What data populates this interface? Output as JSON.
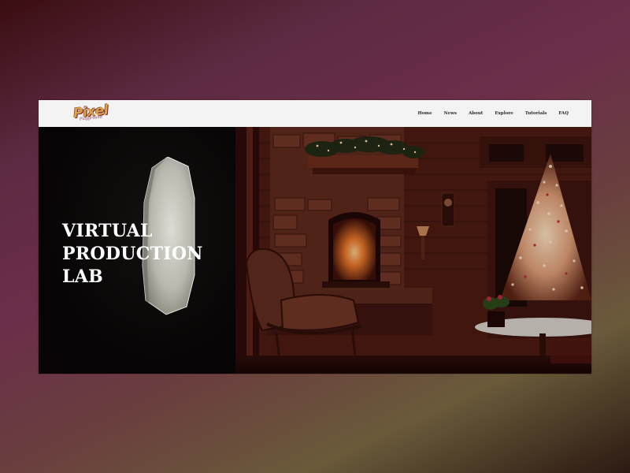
{
  "brand": {
    "name": "Pixel",
    "tagline": "Playground"
  },
  "nav": {
    "items": [
      {
        "label": "Home"
      },
      {
        "label": "News"
      },
      {
        "label": "About"
      },
      {
        "label": "Explore"
      },
      {
        "label": "Tutorials"
      },
      {
        "label": "FAQ"
      }
    ]
  },
  "hero": {
    "title_lines": [
      "VIRTUAL",
      "PRODUCTION",
      "LAB"
    ]
  },
  "colors": {
    "topbar": "#f3f3f3",
    "hero_text": "#ffffff",
    "logo_fill": "#d9a44a",
    "logo_outline": "#7a2a2a"
  }
}
